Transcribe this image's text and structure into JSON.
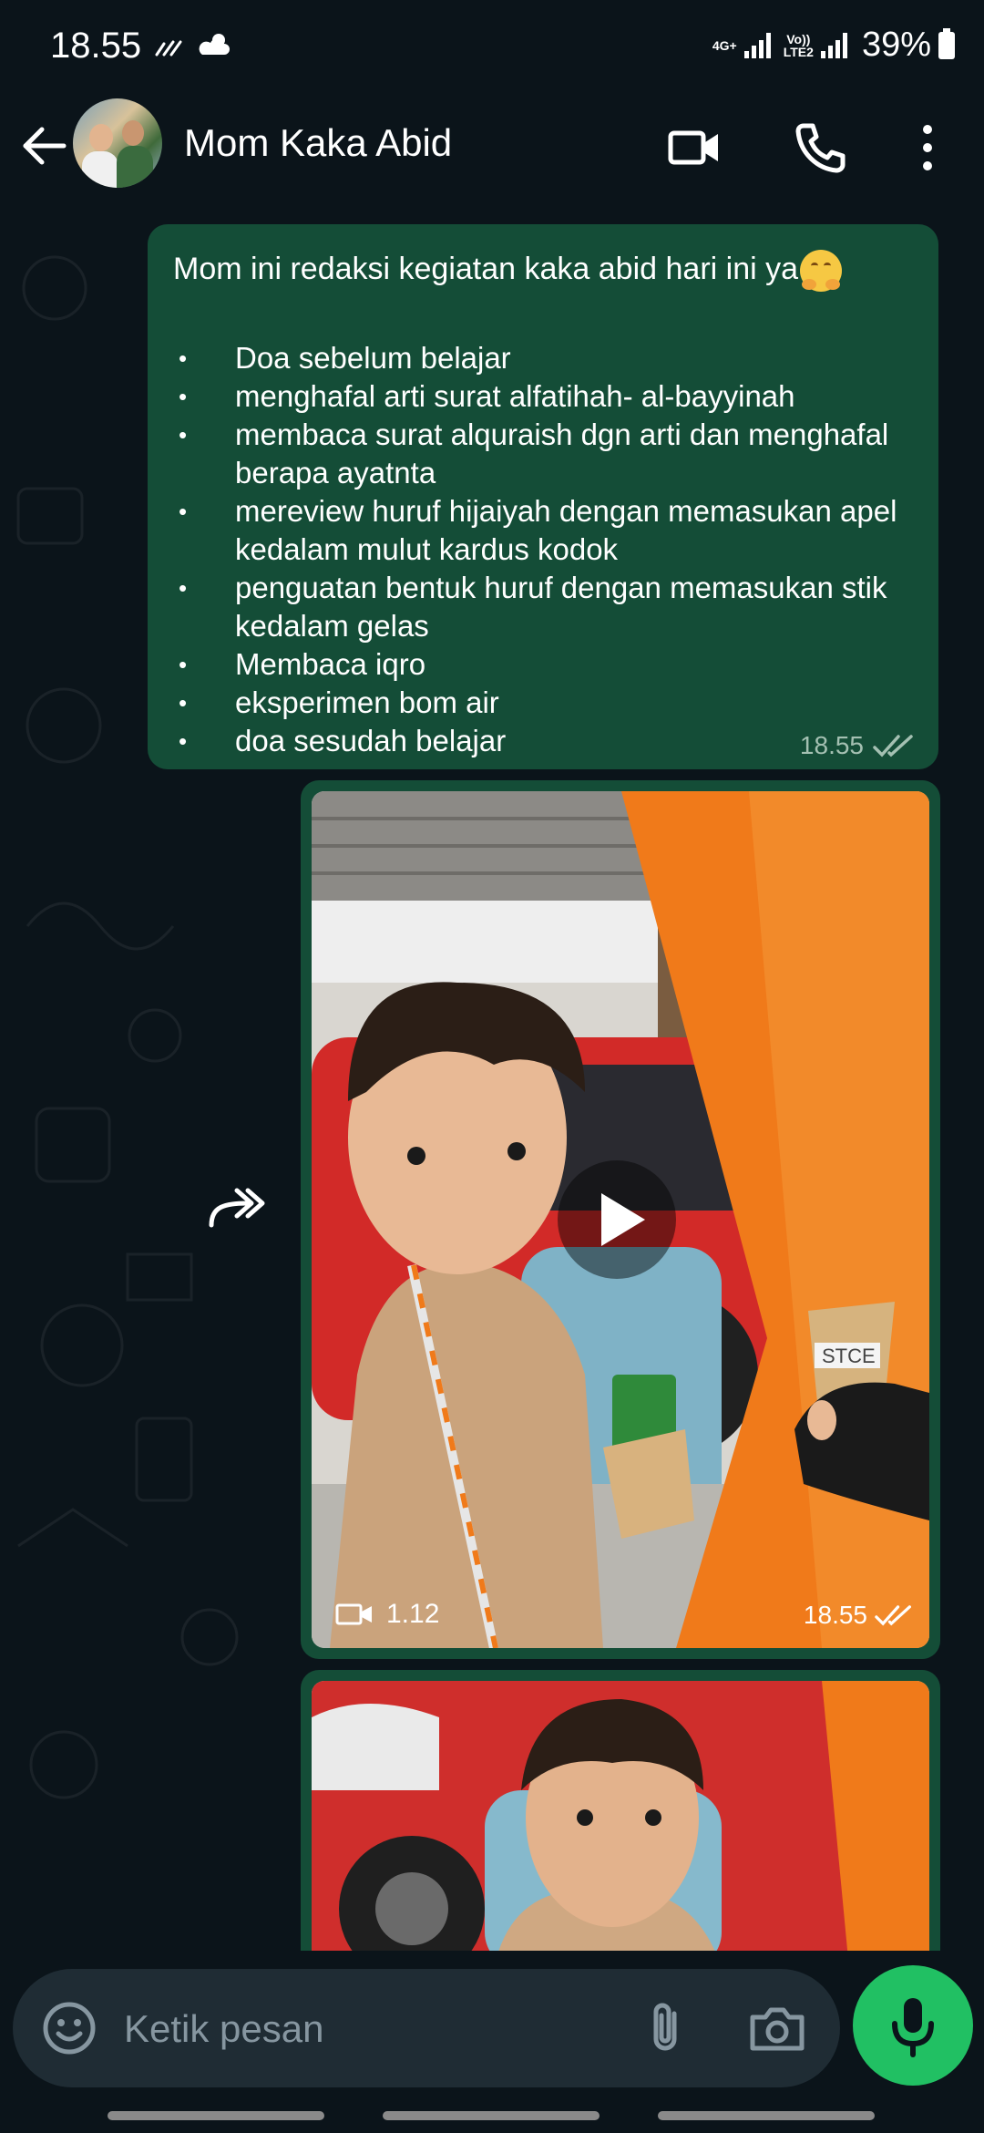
{
  "status_bar": {
    "time": "18.55",
    "network_1": "4G+",
    "network_2_top": "Vo))",
    "network_2_bottom": "LTE2",
    "battery": "39%"
  },
  "header": {
    "contact_name": "Mom Kaka Abid"
  },
  "messages": {
    "text_message": {
      "intro": "Mom ini redaksi kegiatan kaka abid hari ini ya",
      "items": [
        "Doa sebelum belajar",
        "menghafal arti surat alfatihah- al-bayyinah",
        "membaca surat alquraish  dgn arti dan menghafal berapa ayatnta",
        "mereview huruf hijaiyah dengan memasukan apel kedalam mulut kardus kodok",
        "penguatan bentuk huruf dengan memasukan stik kedalam gelas",
        "Membaca iqro",
        "eksperimen bom air",
        "doa sesudah belajar"
      ],
      "time": "18.55"
    },
    "video_message": {
      "duration": "1.12",
      "time": "18.55",
      "cup_label": "STCE"
    }
  },
  "composer": {
    "placeholder": "Ketik pesan"
  },
  "colors": {
    "background": "#0b141a",
    "outgoing_bubble": "#144d37",
    "mic_button": "#21c063",
    "input_bg": "#1f2c34"
  }
}
